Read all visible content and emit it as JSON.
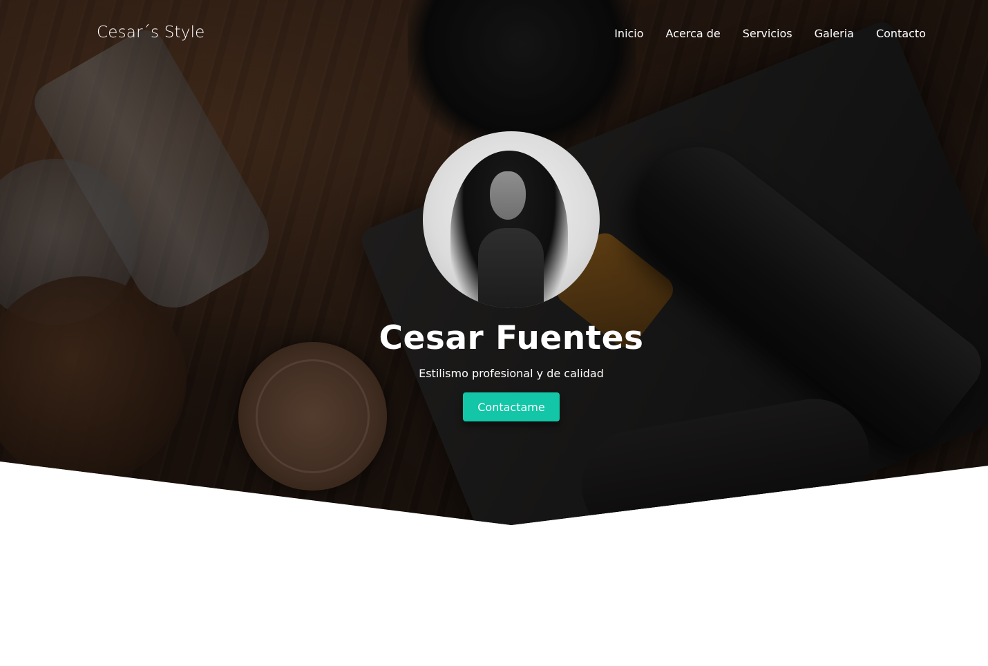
{
  "brand": {
    "title": "Cesar´s Style"
  },
  "nav": {
    "items": [
      {
        "label": "Inicio"
      },
      {
        "label": "Acerca de"
      },
      {
        "label": "Servicios"
      },
      {
        "label": "Galeria"
      },
      {
        "label": "Contacto"
      }
    ]
  },
  "hero": {
    "name": "Cesar Fuentes",
    "tagline": "Estilismo profesional y de calidad",
    "cta_label": "Contactame"
  },
  "colors": {
    "accent": "#12c6a7",
    "text": "#ffffff",
    "page_background": "#ffffff"
  }
}
